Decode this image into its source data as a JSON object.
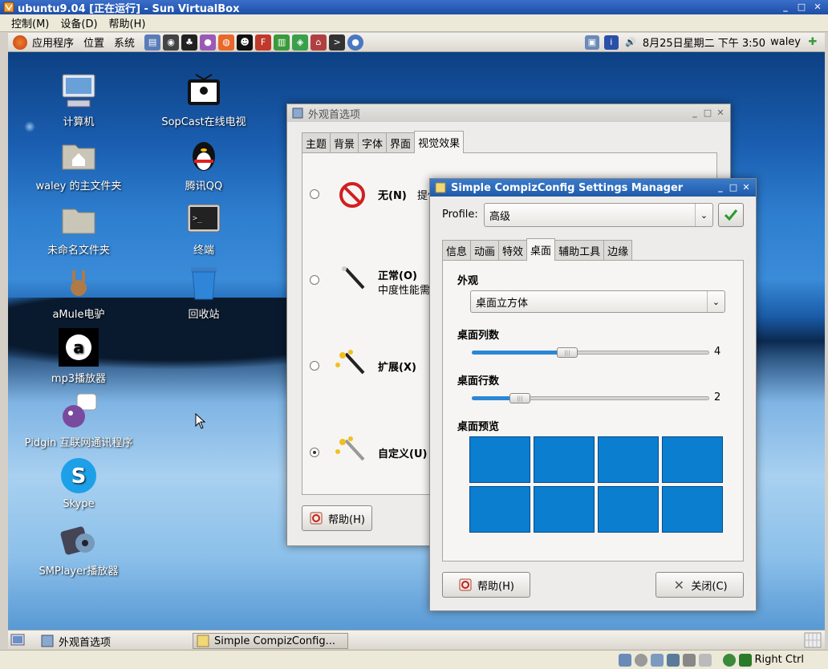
{
  "vbox": {
    "title": "ubuntu9.04 [正在运行] - Sun VirtualBox",
    "menu": [
      "控制(M)",
      "设备(D)",
      "帮助(H)"
    ],
    "status_right_ctrl": "Right Ctrl"
  },
  "top_panel": {
    "menus": [
      "应用程序",
      "位置",
      "系统"
    ],
    "clock": "8月25日星期二 下午 3:50",
    "user": "waley"
  },
  "desktop_icons": [
    {
      "label": "计算机",
      "icon": "computer-icon"
    },
    {
      "label": "waley 的主文件夹",
      "icon": "home-folder-icon"
    },
    {
      "label": "未命名文件夹",
      "icon": "folder-icon"
    },
    {
      "label": "aMule电驴",
      "icon": "amule-icon"
    },
    {
      "label": "mp3播放器",
      "icon": "mp3-player-icon"
    },
    {
      "label": "Pidgin 互联网通讯程序",
      "icon": "pidgin-icon"
    },
    {
      "label": "Skype",
      "icon": "skype-icon"
    },
    {
      "label": "SMPlayer播放器",
      "icon": "smplayer-icon"
    },
    {
      "label": "SopCast在线电视",
      "icon": "sopcast-icon"
    },
    {
      "label": "腾讯QQ",
      "icon": "qq-icon"
    },
    {
      "label": "终端",
      "icon": "terminal-icon"
    },
    {
      "label": "回收站",
      "icon": "trash-icon"
    }
  ],
  "taskbar": {
    "items": [
      "外观首选项",
      "Simple CompizConfig..."
    ]
  },
  "appearance": {
    "title": "外观首选项",
    "tabs": [
      "主题",
      "背景",
      "字体",
      "界面",
      "视觉效果"
    ],
    "options": [
      {
        "title": "无(N)",
        "desc": "提供"
      },
      {
        "title": "正常(O)",
        "desc": "中度性能需"
      },
      {
        "title": "扩展(X)",
        "desc": ""
      },
      {
        "title": "自定义(U)",
        "desc": ""
      }
    ],
    "help": "帮助(H)"
  },
  "ccsm": {
    "title": "Simple CompizConfig Settings Manager",
    "profile_label": "Profile:",
    "profile_value": "高级",
    "tabs": [
      "信息",
      "动画",
      "特效",
      "桌面",
      "辅助工具",
      "边缘"
    ],
    "appearance_label": "外观",
    "appearance_value": "桌面立方体",
    "columns_label": "桌面列数",
    "columns_value": 4,
    "columns_max": 10,
    "rows_label": "桌面行数",
    "rows_value": 2,
    "rows_max": 10,
    "preview_label": "桌面预览",
    "help": "帮助(H)",
    "close": "关闭(C)"
  },
  "colors": {
    "accent": "#2c87d6",
    "workspace": "#0b7ed0"
  }
}
